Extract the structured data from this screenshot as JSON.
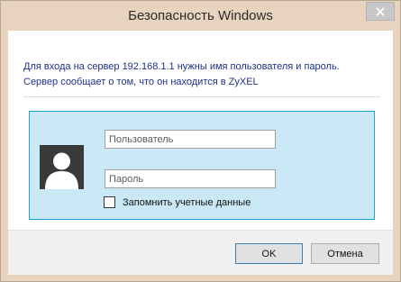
{
  "window": {
    "title": "Безопасность Windows"
  },
  "message": {
    "line1": "Для входа на сервер 192.168.1.1 нужны имя пользователя и пароль.",
    "line2": "Сервер сообщает о том, что он находится в ZyXEL"
  },
  "credentials": {
    "username_placeholder": "Пользователь",
    "username_value": "",
    "password_placeholder": "Пароль",
    "password_value": "",
    "remember_label": "Запомнить учетные данные",
    "remember_checked": false
  },
  "buttons": {
    "ok_label": "OK",
    "cancel_label": "Отмена"
  },
  "icons": {
    "close": "close-icon",
    "user": "user-avatar-icon"
  },
  "colors": {
    "titlebar": "#e8d3be",
    "message_text": "#1e3287",
    "panel_bg": "#cbe8f6",
    "panel_border": "#26a0da"
  }
}
